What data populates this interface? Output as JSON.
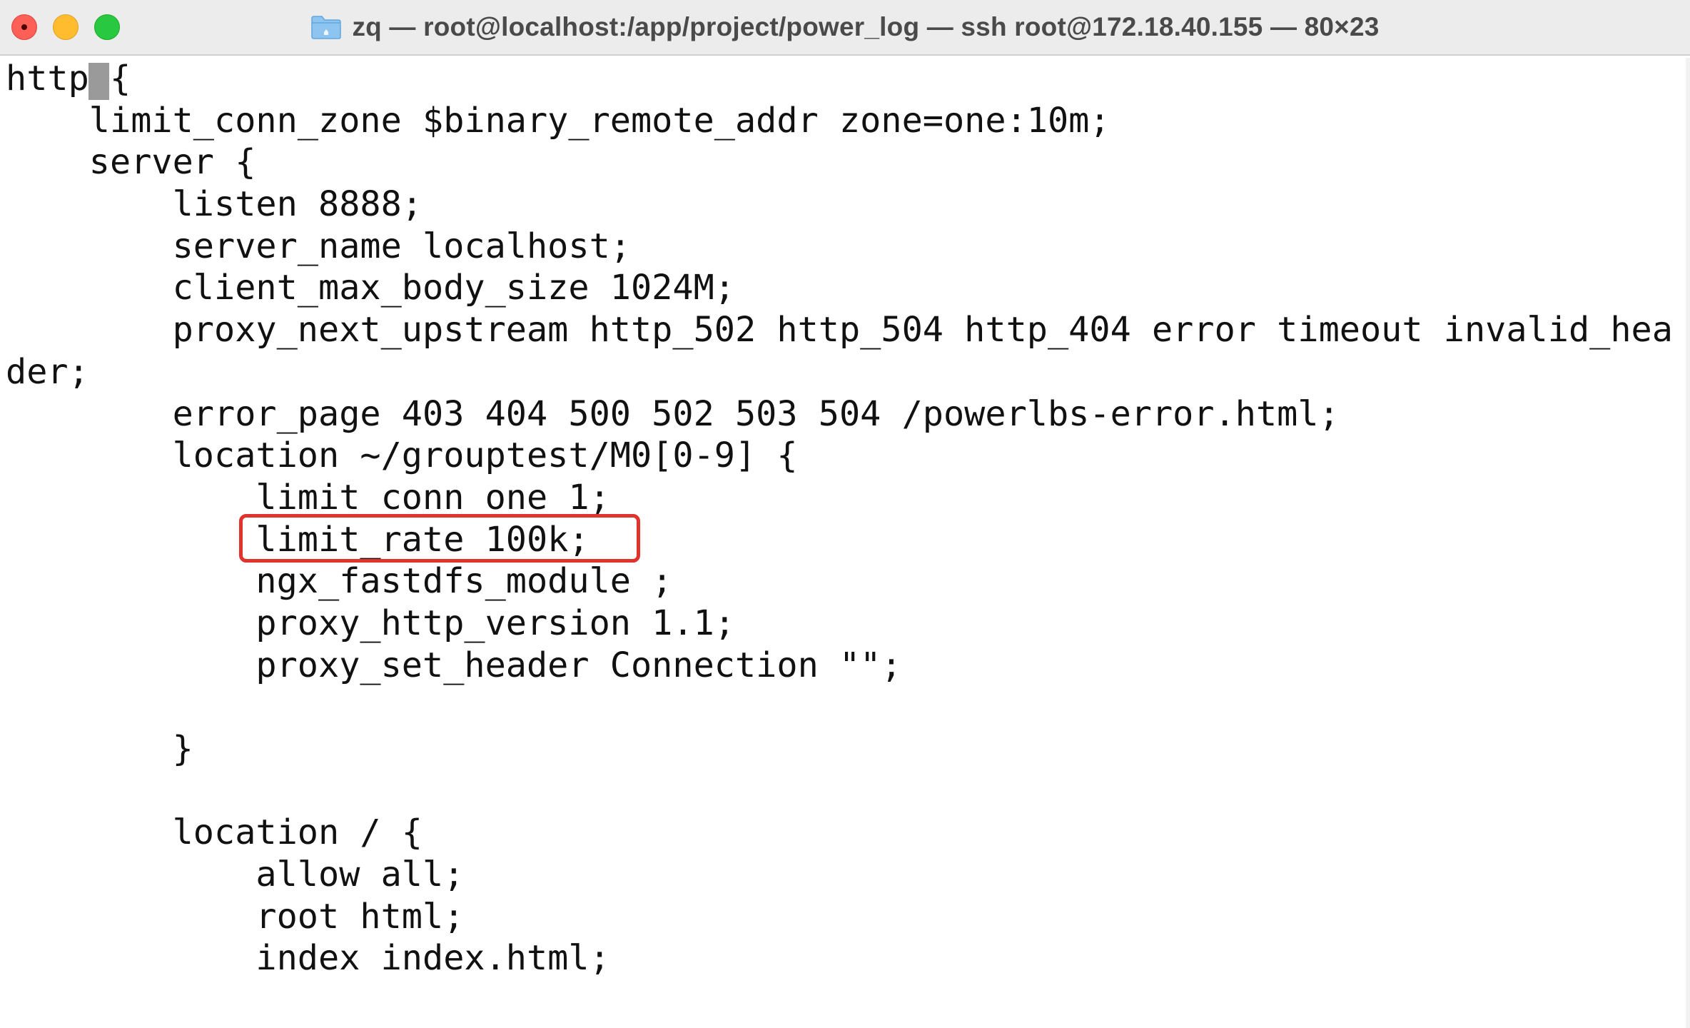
{
  "window": {
    "title": "zq — root@localhost:/app/project/power_log — ssh root@172.18.40.155 — 80×23",
    "title_icon": "folder-icon",
    "buttons": {
      "close": "close-button",
      "minimize": "minimize-button",
      "zoom": "zoom-button"
    }
  },
  "terminal": {
    "lines": [
      "http {",
      "    limit_conn_zone $binary_remote_addr zone=one:10m;",
      "    server {",
      "        listen 8888;",
      "        server_name localhost;",
      "        client_max_body_size 1024M;",
      "        proxy_next_upstream http_502 http_504 http_404 error timeout invalid_hea",
      "der;",
      "        error_page 403 404 500 502 503 504 /powerlbs-error.html;",
      "        location ~/grouptest/M0[0-9] {",
      "            limit_conn one 1;",
      "            limit_rate 100k;",
      "            ngx_fastdfs_module ;",
      "            proxy_http_version 1.1;",
      "            proxy_set_header Connection \"\";",
      "",
      "        }",
      "",
      "        location / {",
      "            allow all;",
      "            root html;",
      "            index index.html;",
      ""
    ],
    "highlighted_line": "limit_rate 100k;",
    "highlight_color": "#e0332e",
    "cursor": {
      "row": 1,
      "col": 5
    }
  }
}
